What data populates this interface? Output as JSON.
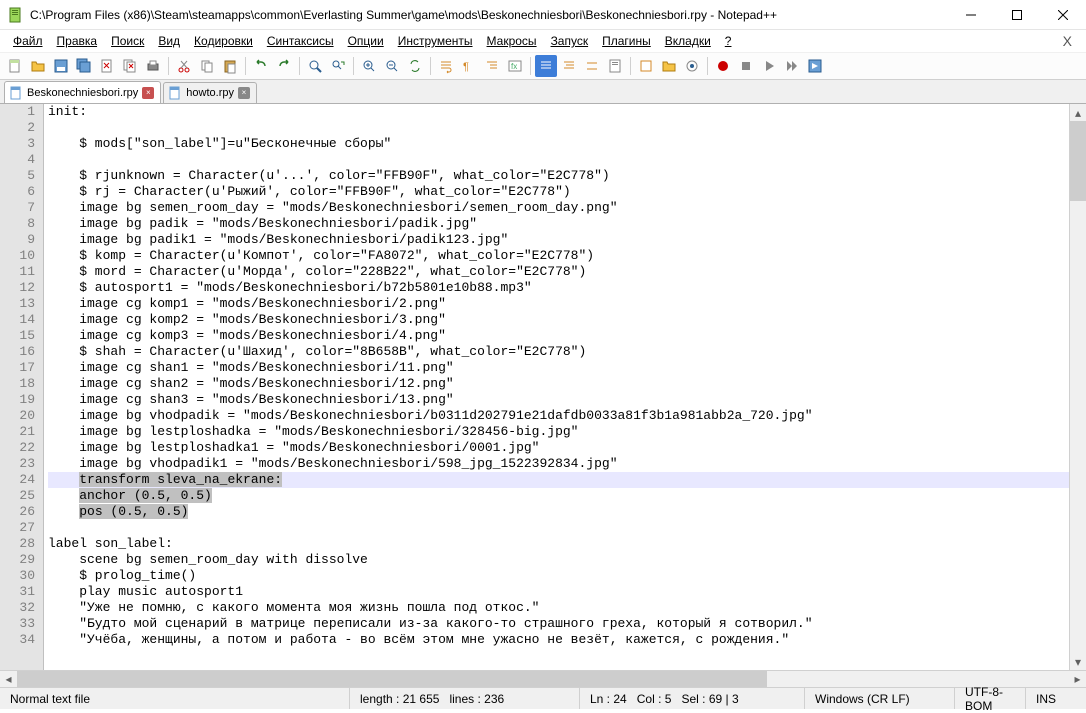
{
  "window": {
    "title": "C:\\Program Files (x86)\\Steam\\steamapps\\common\\Everlasting Summer\\game\\mods\\Beskonechniesbori\\Beskonechniesbori.rpy - Notepad++"
  },
  "menu": {
    "file": "Файл",
    "edit": "Правка",
    "search": "Поиск",
    "view": "Вид",
    "encoding": "Кодировки",
    "syntax": "Синтаксисы",
    "settings": "Опции",
    "tools": "Инструменты",
    "macro": "Макросы",
    "run": "Запуск",
    "plugins": "Плагины",
    "window": "Вкладки",
    "help": "?"
  },
  "tabs": [
    {
      "label": "Beskonechniesbori.rpy",
      "active": true
    },
    {
      "label": "howto.rpy",
      "active": false
    }
  ],
  "code": {
    "lines": [
      "init:",
      "",
      "    $ mods[\"son_label\"]=u\"Бесконечные сборы\"",
      "",
      "    $ rjunknown = Character(u'...', color=\"FFB90F\", what_color=\"E2C778\")",
      "    $ rj = Character(u'Рыжий', color=\"FFB90F\", what_color=\"E2C778\")",
      "    image bg semen_room_day = \"mods/Beskonechniesbori/semen_room_day.png\"",
      "    image bg padik = \"mods/Beskonechniesbori/padik.jpg\"",
      "    image bg padik1 = \"mods/Beskonechniesbori/padik123.jpg\"",
      "    $ komp = Character(u'Компот', color=\"FA8072\", what_color=\"E2C778\")",
      "    $ mord = Character(u'Морда', color=\"228B22\", what_color=\"E2C778\")",
      "    $ autosport1 = \"mods/Beskonechniesbori/b72b5801e10b88.mp3\"",
      "    image cg komp1 = \"mods/Beskonechniesbori/2.png\"",
      "    image cg komp2 = \"mods/Beskonechniesbori/3.png\"",
      "    image cg komp3 = \"mods/Beskonechniesbori/4.png\"",
      "    $ shah = Character(u'Шахид', color=\"8B658B\", what_color=\"E2C778\")",
      "    image cg shan1 = \"mods/Beskonechniesbori/11.png\"",
      "    image cg shan2 = \"mods/Beskonechniesbori/12.png\"",
      "    image cg shan3 = \"mods/Beskonechniesbori/13.png\"",
      "    image bg vhodpadik = \"mods/Beskonechniesbori/b0311d202791e21dafdb0033a81f3b1a981abb2a_720.jpg\"",
      "    image bg lestploshadka = \"mods/Beskonechniesbori/328456-big.jpg\"",
      "    image bg lestploshadka1 = \"mods/Beskonechniesbori/0001.jpg\"",
      "    image bg vhodpadik1 = \"mods/Beskonechniesbori/598_jpg_1522392834.jpg\"",
      "    transform sleva_na_ekrane:",
      "    anchor (0.5, 0.5)",
      "    pos (0.5, 0.5)",
      "",
      "label son_label:",
      "    scene bg semen_room_day with dissolve",
      "    $ prolog_time()",
      "    play music autosport1",
      "    \"Уже не помню, с какого момента моя жизнь пошла под откос.\"",
      "    \"Будто мой сценарий в матрице переписали из-за какого-то страшного греха, который я сотворил.\"",
      "    \"Учёба, женщины, а потом и работа - во всём этом мне ужасно не везёт, кажется, с рождения.\""
    ],
    "highlight_line": 24,
    "selection_lines": [
      24,
      25,
      26
    ],
    "sel_text": {
      "24": "transform sleva_na_ekrane:",
      "25": "anchor (0.5, 0.5)",
      "26": "pos (0.5, 0.5)"
    }
  },
  "status": {
    "filetype": "Normal text file",
    "length_label": "length :",
    "length": "21 655",
    "lines_label": "lines :",
    "lines": "236",
    "ln_label": "Ln :",
    "ln": "24",
    "col_label": "Col :",
    "col": "5",
    "sel_label": "Sel :",
    "sel": "69 | 3",
    "eol": "Windows (CR LF)",
    "encoding": "UTF-8-BOM",
    "mode": "INS"
  },
  "icons": {
    "toolbar": [
      "new",
      "open",
      "save",
      "saveall",
      "close",
      "closeall",
      "print",
      "cut",
      "copy",
      "paste",
      "undo",
      "redo",
      "find",
      "replace",
      "zoomin",
      "zoomout",
      "sync",
      "wrap",
      "allchars",
      "indent",
      "foldall",
      "unfoldall",
      "hidechars",
      "comment",
      "uncomment",
      "run",
      "record",
      "stop",
      "play",
      "fastplay",
      "savemacro"
    ]
  }
}
